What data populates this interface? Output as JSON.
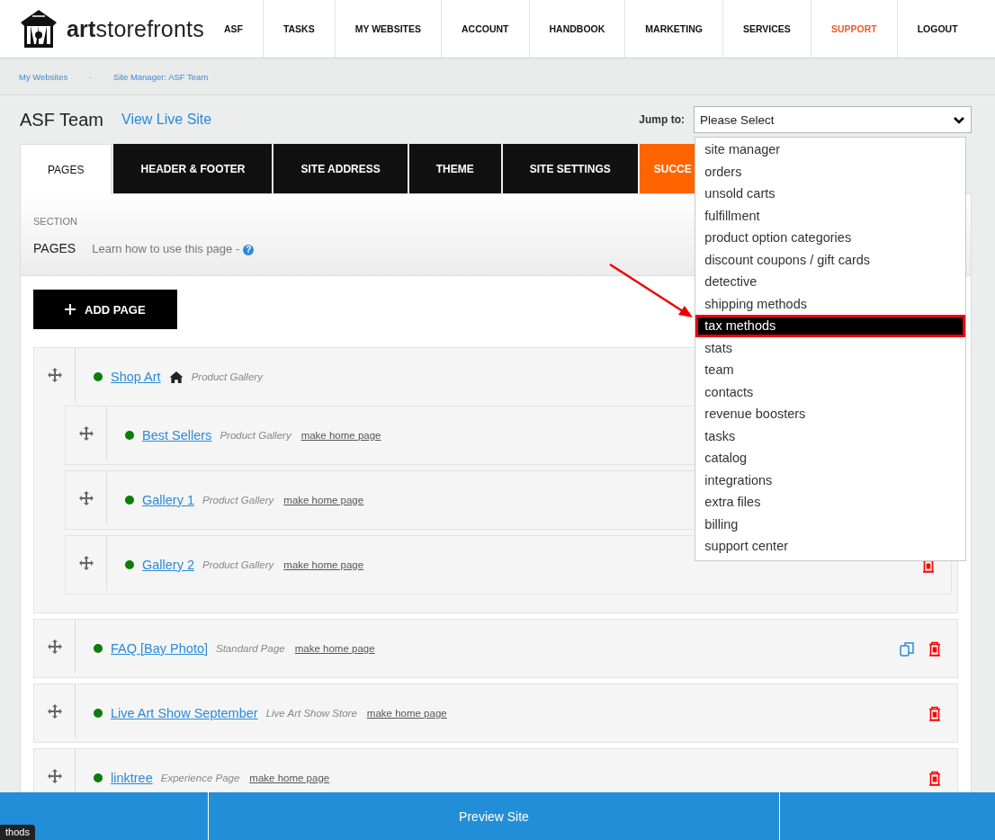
{
  "header": {
    "logo": {
      "bold": "art",
      "rest": "storefronts"
    },
    "nav": [
      {
        "label": "ASF",
        "highlighted": false
      },
      {
        "label": "TASKS",
        "highlighted": false
      },
      {
        "label": "MY WEBSITES",
        "highlighted": false
      },
      {
        "label": "ACCOUNT",
        "highlighted": false
      },
      {
        "label": "HANDBOOK",
        "highlighted": false
      },
      {
        "label": "MARKETING",
        "highlighted": false
      },
      {
        "label": "SERVICES",
        "highlighted": false
      },
      {
        "label": "SUPPORT",
        "highlighted": true
      },
      {
        "label": "LOGOUT",
        "highlighted": false
      }
    ]
  },
  "breadcrumb": {
    "items": [
      "My Websites",
      "Site Manager: ASF Team"
    ],
    "separator": "-"
  },
  "site": {
    "title": "ASF Team",
    "live_link": "View Live Site"
  },
  "jump_to": {
    "label": "Jump to:",
    "value": "Please Select",
    "expanded": true,
    "options": [
      {
        "label": "site manager",
        "selected": false
      },
      {
        "label": "orders",
        "selected": false
      },
      {
        "label": "unsold carts",
        "selected": false
      },
      {
        "label": "fulfillment",
        "selected": false
      },
      {
        "label": "product option categories",
        "selected": false
      },
      {
        "label": "discount coupons / gift cards",
        "selected": false
      },
      {
        "label": "detective",
        "selected": false
      },
      {
        "label": "shipping methods",
        "selected": false
      },
      {
        "label": "tax methods",
        "selected": true
      },
      {
        "label": "stats",
        "selected": false
      },
      {
        "label": "team",
        "selected": false
      },
      {
        "label": "contacts",
        "selected": false
      },
      {
        "label": "revenue boosters",
        "selected": false
      },
      {
        "label": "tasks",
        "selected": false
      },
      {
        "label": "catalog",
        "selected": false
      },
      {
        "label": "integrations",
        "selected": false
      },
      {
        "label": "extra files",
        "selected": false
      },
      {
        "label": "billing",
        "selected": false
      },
      {
        "label": "support center",
        "selected": false
      }
    ]
  },
  "tabs": [
    {
      "label": "PAGES",
      "selected": true,
      "accent": false
    },
    {
      "label": "HEADER & FOOTER",
      "selected": false,
      "accent": false
    },
    {
      "label": "SITE ADDRESS",
      "selected": false,
      "accent": false
    },
    {
      "label": "THEME",
      "selected": false,
      "accent": false
    },
    {
      "label": "SITE SETTINGS",
      "selected": false,
      "accent": false
    },
    {
      "label": "SUCCE",
      "selected": false,
      "accent": true
    }
  ],
  "section": {
    "caption": "SECTION",
    "title": "PAGES",
    "help_text": "Learn how to use this page -",
    "help_icon": "?"
  },
  "add_button": "ADD PAGE",
  "pages": [
    {
      "title": "Shop Art",
      "published": true,
      "home": true,
      "type": "Product Gallery",
      "children": [
        {
          "title": "Best Sellers",
          "published": true,
          "home": false,
          "type": "Product Gallery",
          "make_home": "make home page"
        },
        {
          "title": "Gallery 1",
          "published": true,
          "home": false,
          "type": "Product Gallery",
          "make_home": "make home page"
        },
        {
          "title": "Gallery 2",
          "published": true,
          "home": false,
          "type": "Product Gallery",
          "make_home": "make home page",
          "deletable": true
        }
      ]
    },
    {
      "title": "FAQ [Bay Photo]",
      "published": true,
      "home": false,
      "type": "Standard Page",
      "make_home": "make home page",
      "copyable": true,
      "deletable": true
    },
    {
      "title": "Live Art Show September",
      "published": true,
      "home": false,
      "type": "Live Art Show Store",
      "make_home": "make home page",
      "deletable": true
    },
    {
      "title": "linktree",
      "published": true,
      "home": false,
      "type": "Experience Page",
      "make_home": "make home page",
      "deletable": true
    }
  ],
  "footer": {
    "button": "Preview Site"
  },
  "tooltip": "thods"
}
